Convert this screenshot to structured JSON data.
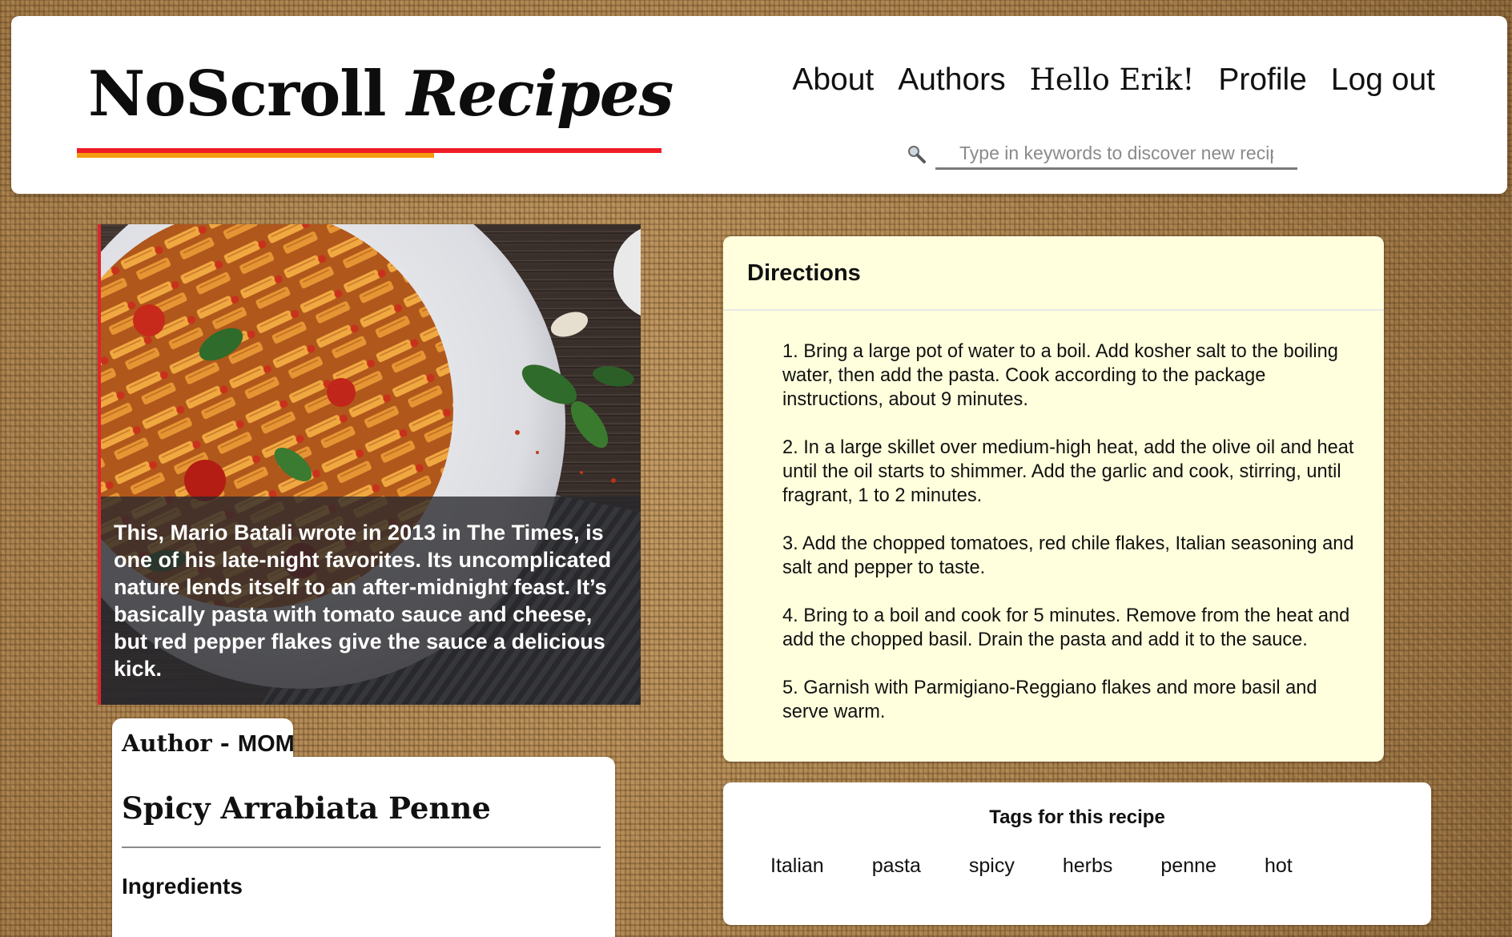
{
  "header": {
    "logo_plain": "NoScroll",
    "logo_italic": "Recipes",
    "nav": {
      "about": "About",
      "authors": "Authors",
      "greeting": "Hello Erik!",
      "profile": "Profile",
      "logout": "Log out"
    },
    "search": {
      "placeholder": "Type in keywords to discover new recipes",
      "icon": "magnifier-icon"
    },
    "colors": {
      "bar_primary": "#ee1c25",
      "bar_secondary": "#f39c12"
    }
  },
  "recipe": {
    "caption": "This, Mario Batali wrote in 2013 in The Times, is one of his late-night favorites. Its uncomplicated nature lends itself to an after-midnight feast. It’s basically pasta with tomato sauce and cheese, but red pepper flakes give the sauce a delicious kick.",
    "author_label": "Author - ",
    "author_name": "MOM",
    "title": "Spicy Arrabiata Penne",
    "ingredients_heading": "Ingredients"
  },
  "directions": {
    "heading": "Directions",
    "steps": [
      "1. Bring a large pot of water to a boil. Add kosher salt to the boiling water, then add the pasta. Cook according to the package instructions, about 9 minutes.",
      "2. In a large skillet over medium-high heat, add the olive oil and heat until the oil starts to shimmer. Add the garlic and cook, stirring, until fragrant, 1 to 2 minutes.",
      "3. Add the chopped tomatoes, red chile flakes, Italian seasoning and salt and pepper to taste.",
      "4. Bring to a boil and cook for 5 minutes. Remove from the heat and add the chopped basil. Drain the pasta and add it to the sauce.",
      "5. Garnish with Parmigiano-Reggiano flakes and more basil and serve warm."
    ],
    "background": "#ffffdd"
  },
  "tags": {
    "heading": "Tags for this recipe",
    "items": [
      "Italian",
      "pasta",
      "spicy",
      "herbs",
      "penne",
      "hot"
    ]
  }
}
